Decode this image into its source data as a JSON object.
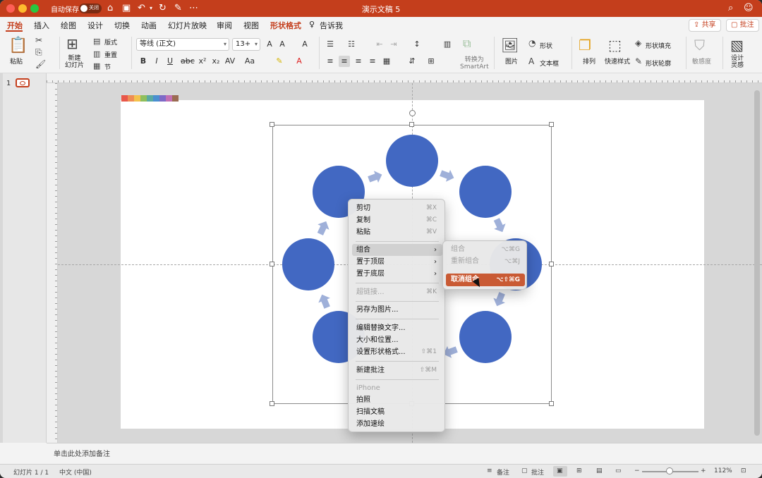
{
  "window": {
    "title": "演示文稿 5",
    "autosave_label": "自动保存",
    "autosave_state": "关闭"
  },
  "tabs": [
    "开始",
    "插入",
    "绘图",
    "设计",
    "切换",
    "动画",
    "幻灯片放映",
    "审阅",
    "视图",
    "形状格式",
    "告诉我"
  ],
  "active_tab": "开始",
  "header_buttons": {
    "share": "共享",
    "comment": "批注"
  },
  "ribbon": {
    "paste": "粘贴",
    "new_slide": "新建\n幻灯片",
    "layout": "版式",
    "reset": "重置",
    "section": "节",
    "font_name": "等线 (正文)",
    "font_size": "13+",
    "convert_smartart": "转换为\nSmartArt",
    "picture": "图片",
    "shape": "形状",
    "textbox": "文本框",
    "arrange": "排列",
    "quick_styles": "快速样式",
    "shape_fill": "形状填充",
    "shape_outline": "形状轮廓",
    "sensitivity": "敏感度",
    "designer": "设计\n灵感"
  },
  "thumbnails": {
    "slide_number": "1"
  },
  "context_menu": {
    "items": [
      {
        "label": "剪切",
        "shortcut": "⌘X",
        "disabled": false
      },
      {
        "label": "复制",
        "shortcut": "⌘C",
        "disabled": false
      },
      {
        "label": "粘贴",
        "shortcut": "⌘V",
        "disabled": false
      },
      {
        "label": "组合",
        "submenu": true,
        "highlight": true
      },
      {
        "label": "置于顶层",
        "submenu": true
      },
      {
        "label": "置于底层",
        "submenu": true
      },
      {
        "label": "超链接...",
        "shortcut": "⌘K",
        "disabled": true
      },
      {
        "label": "另存为图片...",
        "disabled": false
      },
      {
        "label": "编辑替换文字...",
        "disabled": false
      },
      {
        "label": "大小和位置...",
        "disabled": false
      },
      {
        "label": "设置形状格式...",
        "shortcut": "⇧⌘1",
        "disabled": false
      },
      {
        "label": "新建批注",
        "shortcut": "⇧⌘M",
        "disabled": false
      },
      {
        "label": "iPhone",
        "disabled": true
      },
      {
        "label": "拍照",
        "disabled": false
      },
      {
        "label": "扫描文稿",
        "disabled": false
      },
      {
        "label": "添加速绘",
        "disabled": false
      }
    ]
  },
  "submenu": {
    "items": [
      {
        "label": "组合",
        "shortcut": "⌥⌘G",
        "state": "disabled"
      },
      {
        "label": "重新组合",
        "shortcut": "⌥⌘J",
        "state": "disabled"
      },
      {
        "label": "取消组合",
        "shortcut": "⌥⇧⌘G",
        "state": "active"
      }
    ]
  },
  "notes_placeholder": "单击此处添加备注",
  "status": {
    "slide_indicator": "幻灯片 1 / 1",
    "language": "中文 (中国)",
    "notes": "备注",
    "comments": "批注",
    "zoom": "112%"
  },
  "colors": {
    "accent": "#c43e1c",
    "circle": "#4268c2",
    "arrow": "#9fb0d9",
    "active_menu": "#c95a34",
    "swatches": [
      "#e8574a",
      "#ef8c54",
      "#f3c24d",
      "#8fbf5c",
      "#59a9a2",
      "#4a8fd0",
      "#7d6ac7",
      "#c26fb3",
      "#9b6b52"
    ]
  }
}
